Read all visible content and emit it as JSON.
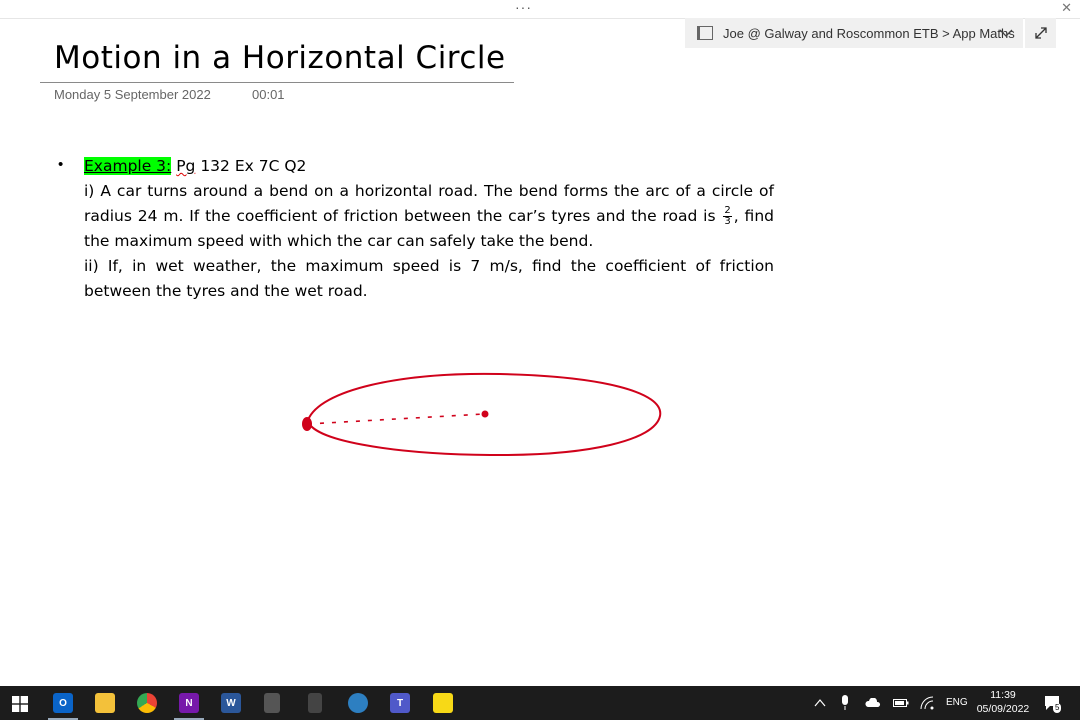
{
  "window": {
    "title_dots": "···",
    "close_symbol": "✕"
  },
  "notebook": {
    "path": "Joe @ Galway and Roscommon ETB > App Maths"
  },
  "page": {
    "title": "Motion in a Horizontal Circle",
    "date": "Monday 5 September 2022",
    "time": "00:01"
  },
  "note": {
    "bullet": "•",
    "example_label": "Example 3:",
    "ref_pg": "Pg",
    "ref_rest": " 132 Ex 7C Q2",
    "part1_a": "i) A car turns around a bend on a horizontal road. The bend forms the arc of a circle of radius 24 m. If the coefficient of friction between the car’s tyres and the road is ",
    "frac_num": "2",
    "frac_den": "3",
    "part1_b": ", find the maximum speed with which the car can safely take the bend.",
    "part2": "ii) If, in wet weather, the maximum speed is 7 m/s, find the coefficient of friction between the tyres and the wet road."
  },
  "colors": {
    "ink": "#d0021b",
    "highlight": "#00ff00",
    "taskbar": "#1c1c1c"
  },
  "taskbar": {
    "apps": [
      "windows-start",
      "outlook",
      "file-explorer",
      "chrome",
      "onenote",
      "word",
      "calculator",
      "calculator-2",
      "app",
      "teams",
      "sticky-notes"
    ],
    "language": "ENG",
    "clock_time": "11:39",
    "clock_date": "05/09/2022",
    "notification_count": "5"
  }
}
